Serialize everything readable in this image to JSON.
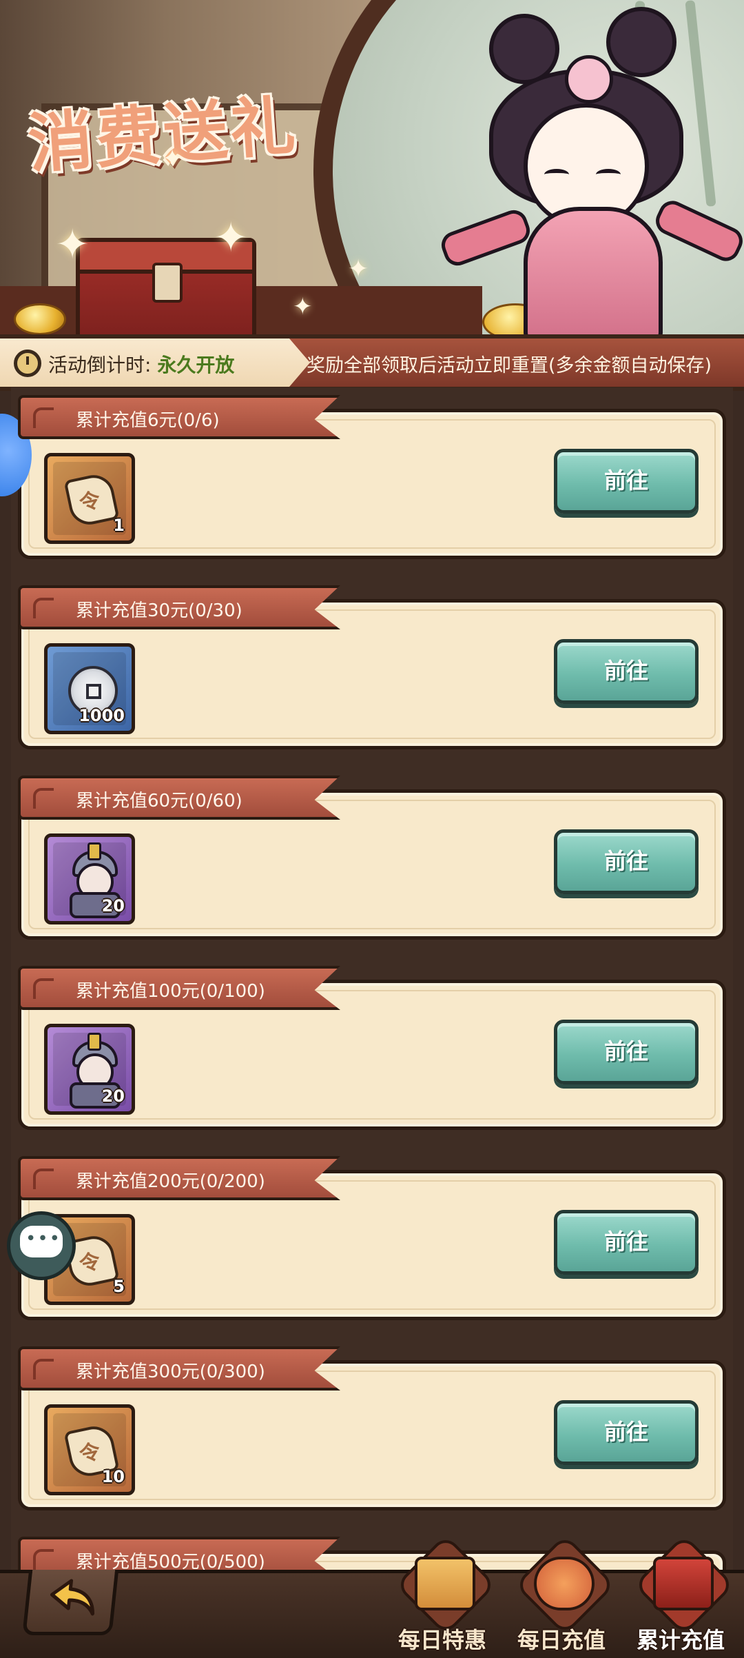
{
  "banner": {
    "title": "消费送礼"
  },
  "timer": {
    "label": "活动倒计时: ",
    "value": "永久开放",
    "notice": "奖励全部领取后活动立即重置(多余金额自动保存)"
  },
  "tiers": [
    {
      "title": "累计充值6元(0/6)",
      "item": "token-scroll-icon",
      "quantity": "1",
      "button": "前往"
    },
    {
      "title": "累计充值30元(0/30)",
      "item": "silver-coin-icon",
      "quantity": "1000",
      "button": "前往"
    },
    {
      "title": "累计充值60元(0/60)",
      "item": "hero-portrait-icon",
      "quantity": "20",
      "button": "前往"
    },
    {
      "title": "累计充值100元(0/100)",
      "item": "hero-portrait-icon",
      "quantity": "20",
      "button": "前往"
    },
    {
      "title": "累计充值200元(0/200)",
      "item": "token-scroll-icon",
      "quantity": "5",
      "button": "前往"
    },
    {
      "title": "累计充值300元(0/300)",
      "item": "token-scroll-icon",
      "quantity": "10",
      "button": "前往"
    },
    {
      "title": "累计充值500元(0/500)"
    }
  ],
  "bottom_nav": {
    "tabs": [
      {
        "label": "每日特惠",
        "icon": "gift-box-icon"
      },
      {
        "label": "每日充值",
        "icon": "money-bag-icon"
      },
      {
        "label": "累计充值",
        "icon": "treasure-chest-icon",
        "active": true
      }
    ]
  },
  "colors": {
    "button": "#6fbcac",
    "tab": "#a24d3c",
    "card": "#f8e9cb"
  }
}
